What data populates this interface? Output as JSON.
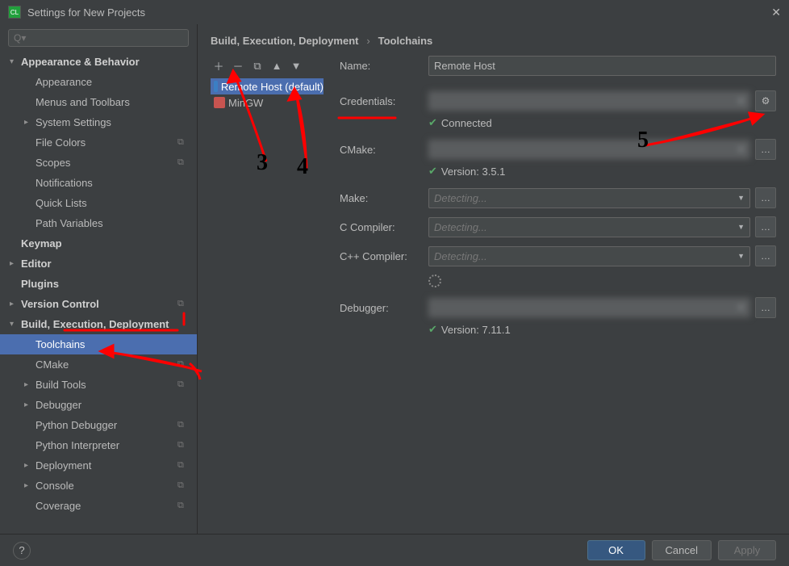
{
  "titlebar": {
    "title": "Settings for New Projects"
  },
  "search": {
    "placeholder": "Q▾"
  },
  "sidebar": {
    "items": [
      {
        "label": "Appearance & Behavior",
        "bold": true,
        "expanded": true,
        "indent": 0
      },
      {
        "label": "Appearance",
        "indent": 1
      },
      {
        "label": "Menus and Toolbars",
        "indent": 1
      },
      {
        "label": "System Settings",
        "indent": 1,
        "arrow": ">"
      },
      {
        "label": "File Colors",
        "indent": 1,
        "copy": true
      },
      {
        "label": "Scopes",
        "indent": 1,
        "copy": true
      },
      {
        "label": "Notifications",
        "indent": 1
      },
      {
        "label": "Quick Lists",
        "indent": 1
      },
      {
        "label": "Path Variables",
        "indent": 1
      },
      {
        "label": "Keymap",
        "bold": true,
        "indent": 0
      },
      {
        "label": "Editor",
        "bold": true,
        "indent": 0,
        "arrow": ">"
      },
      {
        "label": "Plugins",
        "bold": true,
        "indent": 0
      },
      {
        "label": "Version Control",
        "bold": true,
        "indent": 0,
        "arrow": ">",
        "copy": true
      },
      {
        "label": "Build, Execution, Deployment",
        "bold": true,
        "indent": 0,
        "expanded": true
      },
      {
        "label": "Toolchains",
        "indent": 1,
        "selected": true
      },
      {
        "label": "CMake",
        "indent": 1,
        "copy": true
      },
      {
        "label": "Build Tools",
        "indent": 1,
        "arrow": ">",
        "copy": true
      },
      {
        "label": "Debugger",
        "indent": 1,
        "arrow": ">"
      },
      {
        "label": "Python Debugger",
        "indent": 1,
        "copy": true
      },
      {
        "label": "Python Interpreter",
        "indent": 1,
        "copy": true
      },
      {
        "label": "Deployment",
        "indent": 1,
        "arrow": ">",
        "copy": true
      },
      {
        "label": "Console",
        "indent": 1,
        "arrow": ">",
        "copy": true
      },
      {
        "label": "Coverage",
        "indent": 1,
        "copy": true
      }
    ]
  },
  "breadcrumb": {
    "part1": "Build, Execution, Deployment",
    "part2": "Toolchains"
  },
  "toolchains": {
    "items": [
      {
        "label": "Remote Host (default)",
        "selected": true,
        "icon_color": "#3b7fc4"
      },
      {
        "label": "MinGW",
        "icon_color": "#c75450"
      }
    ]
  },
  "form": {
    "name_label": "Name:",
    "name_value": "Remote Host",
    "credentials_label": "Credentials:",
    "connected": "Connected",
    "cmake_label": "CMake:",
    "cmake_version": "Version: 3.5.1",
    "make_label": "Make:",
    "make_value": "Detecting...",
    "cc_label": "C Compiler:",
    "cc_value": "Detecting...",
    "cxx_label": "C++ Compiler:",
    "cxx_value": "Detecting...",
    "debugger_label": "Debugger:",
    "debugger_version": "Version: 7.11.1"
  },
  "footer": {
    "ok": "OK",
    "cancel": "Cancel",
    "apply": "Apply"
  }
}
